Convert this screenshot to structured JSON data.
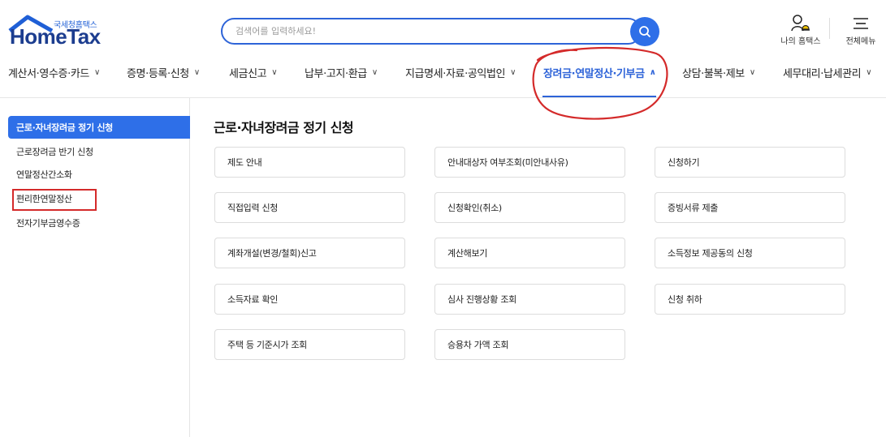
{
  "header": {
    "logo_sub": "국세청홈택스",
    "logo_main": "HomeTax",
    "search_placeholder": "검색어를 입력하세요!",
    "my_hometax_label": "나의 홈택스",
    "all_menu_label": "전체메뉴"
  },
  "nav": {
    "items": [
      {
        "label": "계산서·영수증·카드"
      },
      {
        "label": "증명·등록·신청"
      },
      {
        "label": "세금신고"
      },
      {
        "label": "납부·고지·환급"
      },
      {
        "label": "지급명세·자료·공익법인"
      },
      {
        "label": "장려금·연말정산·기부금"
      },
      {
        "label": "상담·불복·제보"
      },
      {
        "label": "세무대리·납세관리"
      }
    ],
    "active_index": 5
  },
  "sidebar": {
    "items": [
      {
        "label": "근로·자녀장려금 정기 신청"
      },
      {
        "label": "근로장려금 반기 신청"
      },
      {
        "label": "연말정산간소화"
      },
      {
        "label": "편리한연말정산"
      },
      {
        "label": "전자기부금영수증"
      }
    ],
    "active_index": 0
  },
  "main": {
    "title": "근로·자녀장려금 정기 신청",
    "cards": [
      {
        "label": "제도 안내"
      },
      {
        "label": "안내대상자 여부조회(미안내사유)"
      },
      {
        "label": "신청하기"
      },
      {
        "label": "직접입력 신청"
      },
      {
        "label": "신청확인(취소)"
      },
      {
        "label": "증빙서류 제출"
      },
      {
        "label": "계좌개설(변경/철회)신고"
      },
      {
        "label": "계산해보기"
      },
      {
        "label": "소득정보 제공동의 신청"
      },
      {
        "label": "소득자료 확인"
      },
      {
        "label": "심사 진행상황 조회"
      },
      {
        "label": "신청 취하"
      },
      {
        "label": "주택 등 기준시가 조회"
      },
      {
        "label": "승용차 가액 조회"
      }
    ]
  },
  "icons": {
    "search": "search-icon",
    "user": "user-bell-icon",
    "menu": "hamburger-menu-icon",
    "chevron_down": "chevron-down-icon",
    "chevron_up": "chevron-up-icon"
  },
  "colors": {
    "primary": "#2e6fe8",
    "brand_dark": "#1c3d8f",
    "annotation": "#d42a2a"
  }
}
